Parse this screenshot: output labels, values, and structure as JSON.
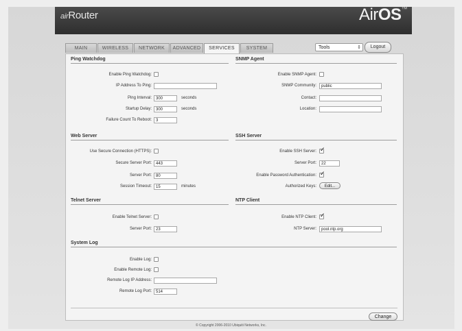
{
  "app": {
    "brand_prefix": "air",
    "brand_name": "Router",
    "logo_main": "Air",
    "logo_os": "OS",
    "logo_tm": "™"
  },
  "tabs": [
    "MAIN",
    "WIRELESS",
    "NETWORK",
    "ADVANCED",
    "SERVICES",
    "SYSTEM"
  ],
  "active_tab": "SERVICES",
  "toolbar": {
    "tools_label": "Tools",
    "tools_arrow": "⇕",
    "logout_label": "Logout"
  },
  "ping_watchdog": {
    "title": "Ping Watchdog",
    "enable_label": "Enable Ping Watchdog:",
    "ip_label": "IP Address To Ping:",
    "ip_value": "",
    "interval_label": "Ping Interval:",
    "interval_value": "300",
    "interval_unit": "seconds",
    "delay_label": "Startup Delay:",
    "delay_value": "300",
    "delay_unit": "seconds",
    "failure_label": "Failure Count To Reboot:",
    "failure_value": "3"
  },
  "snmp": {
    "title": "SNMP Agent",
    "enable_label": "Enable SNMP Agent:",
    "community_label": "SNMP Community:",
    "community_value": "public",
    "contact_label": "Contact:",
    "contact_value": "",
    "location_label": "Location:",
    "location_value": ""
  },
  "web_server": {
    "title": "Web Server",
    "https_label": "Use Secure Connection (HTTPS):",
    "secure_port_label": "Secure Server Port:",
    "secure_port_value": "443",
    "port_label": "Server Port:",
    "port_value": "80",
    "timeout_label": "Session Timeout:",
    "timeout_value": "15",
    "timeout_unit": "minutes"
  },
  "ssh": {
    "title": "SSH Server",
    "enable_label": "Enable SSH Server:",
    "port_label": "Server Port:",
    "port_value": "22",
    "password_label": "Enable Password Authentication:",
    "keys_label": "Authorized Keys:",
    "edit_label": "Edit..."
  },
  "telnet": {
    "title": "Telnet Server",
    "enable_label": "Enable Telnet Server:",
    "port_label": "Server Port:",
    "port_value": "23"
  },
  "ntp": {
    "title": "NTP Client",
    "enable_label": "Enable NTP Client:",
    "server_label": "NTP Server:",
    "server_value": "pool.ntp.org"
  },
  "syslog": {
    "title": "System Log",
    "enable_label": "Enable Log:",
    "remote_label": "Enable Remote Log:",
    "remote_ip_label": "Remote Log IP Address:",
    "remote_ip_value": "",
    "remote_port_label": "Remote Log Port:",
    "remote_port_value": "514"
  },
  "actions": {
    "change_label": "Change"
  },
  "footer": {
    "copyright": "© Copyright 2006-2010 Ubiquiti Networks, Inc."
  }
}
